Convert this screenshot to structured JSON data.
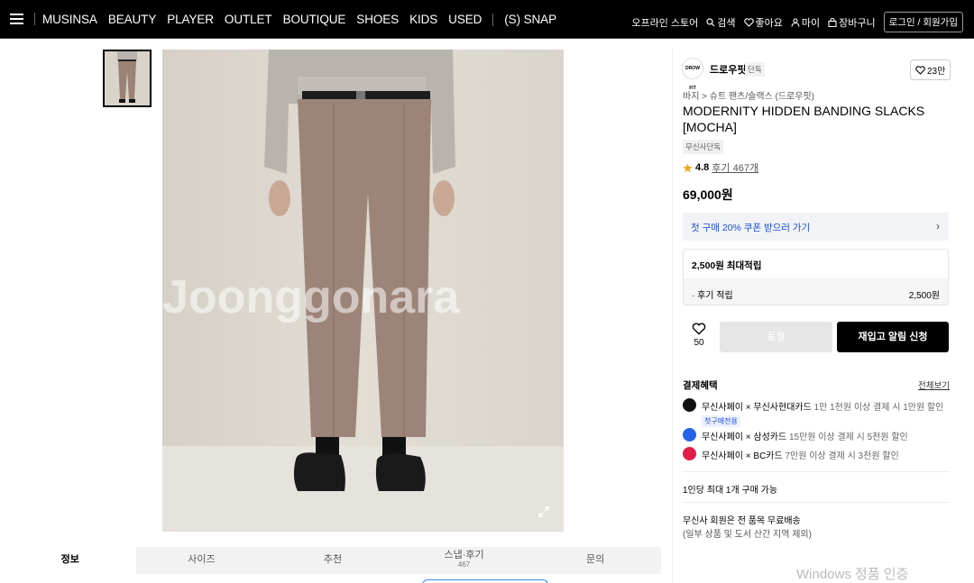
{
  "nav": {
    "menu_icon": "hamburger-icon",
    "links": [
      "MUSINSA",
      "BEAUTY",
      "PLAYER",
      "OUTLET",
      "BOUTIQUE",
      "SHOES",
      "KIDS",
      "USED"
    ],
    "snap": "(S) SNAP",
    "offline_store": "오프라인 스토어",
    "search": "검색",
    "likes": "좋아요",
    "my": "마이",
    "cart": "장바구니",
    "login": "로그인 / 회원가입"
  },
  "gallery": {
    "watermark": "Joonggonara",
    "zoom_icon": "expand-icon"
  },
  "tabs": [
    {
      "label": "정보"
    },
    {
      "label": "사이즈"
    },
    {
      "label": "추천"
    },
    {
      "label": "스냅·후기",
      "sub": "467"
    },
    {
      "label": "문의"
    }
  ],
  "product": {
    "brand_logo_text": "DROW FIT",
    "brand": "드로우핏",
    "brand_badge": "단독",
    "likes": "23만",
    "breadcrumb": "바지 > 슈트 팬츠/슬랙스 (드로우핏)",
    "title": "MODERNITY HIDDEN BANDING SLACKS [MOCHA]",
    "exclusive": "무신사단독",
    "rating": "4.8",
    "reviews": "후기 467개",
    "price": "69,000원",
    "coupon": "첫 구매 20% 쿠폰 받으러 가기",
    "max_points": "2,500원 최대적립",
    "review_points_label": "· 후기 적립",
    "review_points_value": "2,500원",
    "wish_count": "50",
    "soldout": "품절",
    "restock": "재입고 알림 신청"
  },
  "benefits": {
    "title": "결제혜택",
    "all": "전체보기",
    "items": [
      {
        "strong": "무신사페이 × 무신사현대카드",
        "muted": "1만 1천원 이상 결제 시 1만원 할인",
        "tag": "첫구매전용",
        "color": "#111111"
      },
      {
        "strong": "무신사페이 × 삼성카드",
        "muted": "15만원 이상 결제 시 5천원 할인",
        "color": "#2563eb"
      },
      {
        "strong": "무신사페이 × BC카드",
        "muted": "7만원 이상 결제 시 3천원 할인",
        "color": "#e11d48"
      }
    ]
  },
  "limit": "1인당 최대 1개 구매 가능",
  "shipping": {
    "line1": "무신사 회원은 전 품목 무료배송",
    "line2": "(일부 상품 및 도서 산간 지역 제외)"
  },
  "windows_text": "Windows 정품 인증"
}
